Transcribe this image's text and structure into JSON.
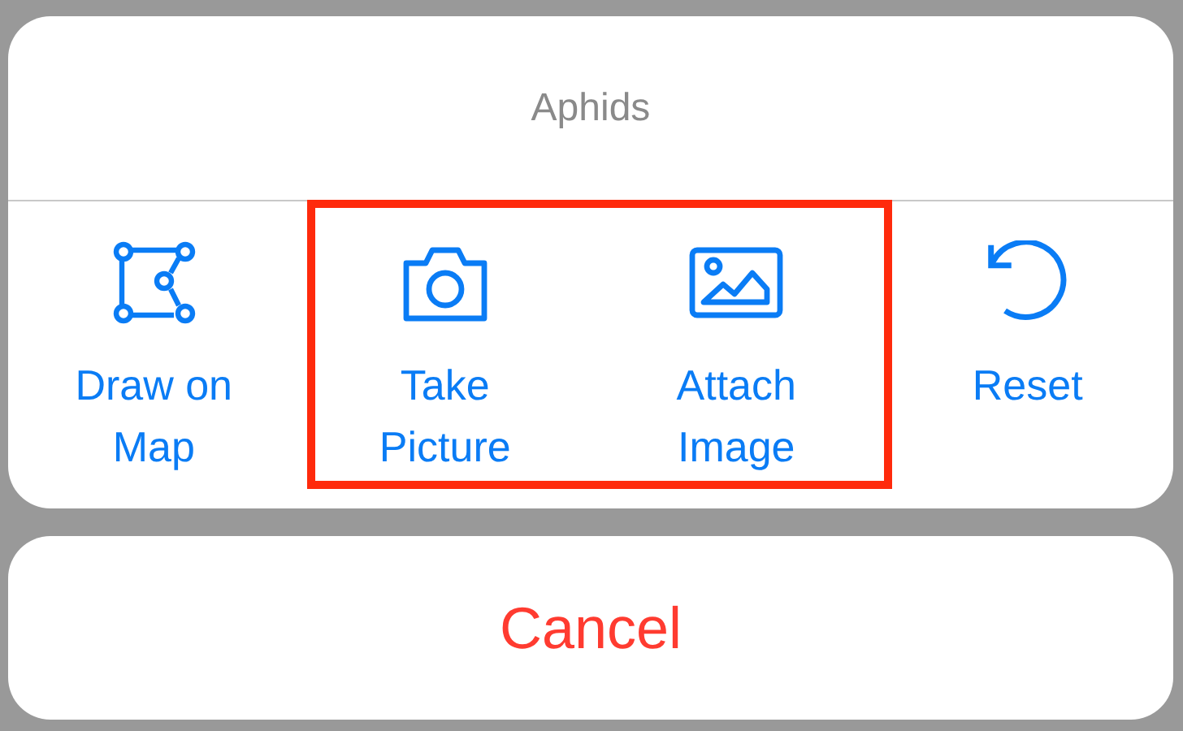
{
  "sheet": {
    "title": "Aphids",
    "actions": [
      {
        "kind": "draw",
        "label": "Draw on Map",
        "highlighted": false
      },
      {
        "kind": "camera",
        "label": "Take Picture",
        "highlighted": true
      },
      {
        "kind": "image",
        "label": "Attach Image",
        "highlighted": true
      },
      {
        "kind": "reset",
        "label": "Reset",
        "highlighted": false
      }
    ]
  },
  "cancel_button": "Cancel"
}
